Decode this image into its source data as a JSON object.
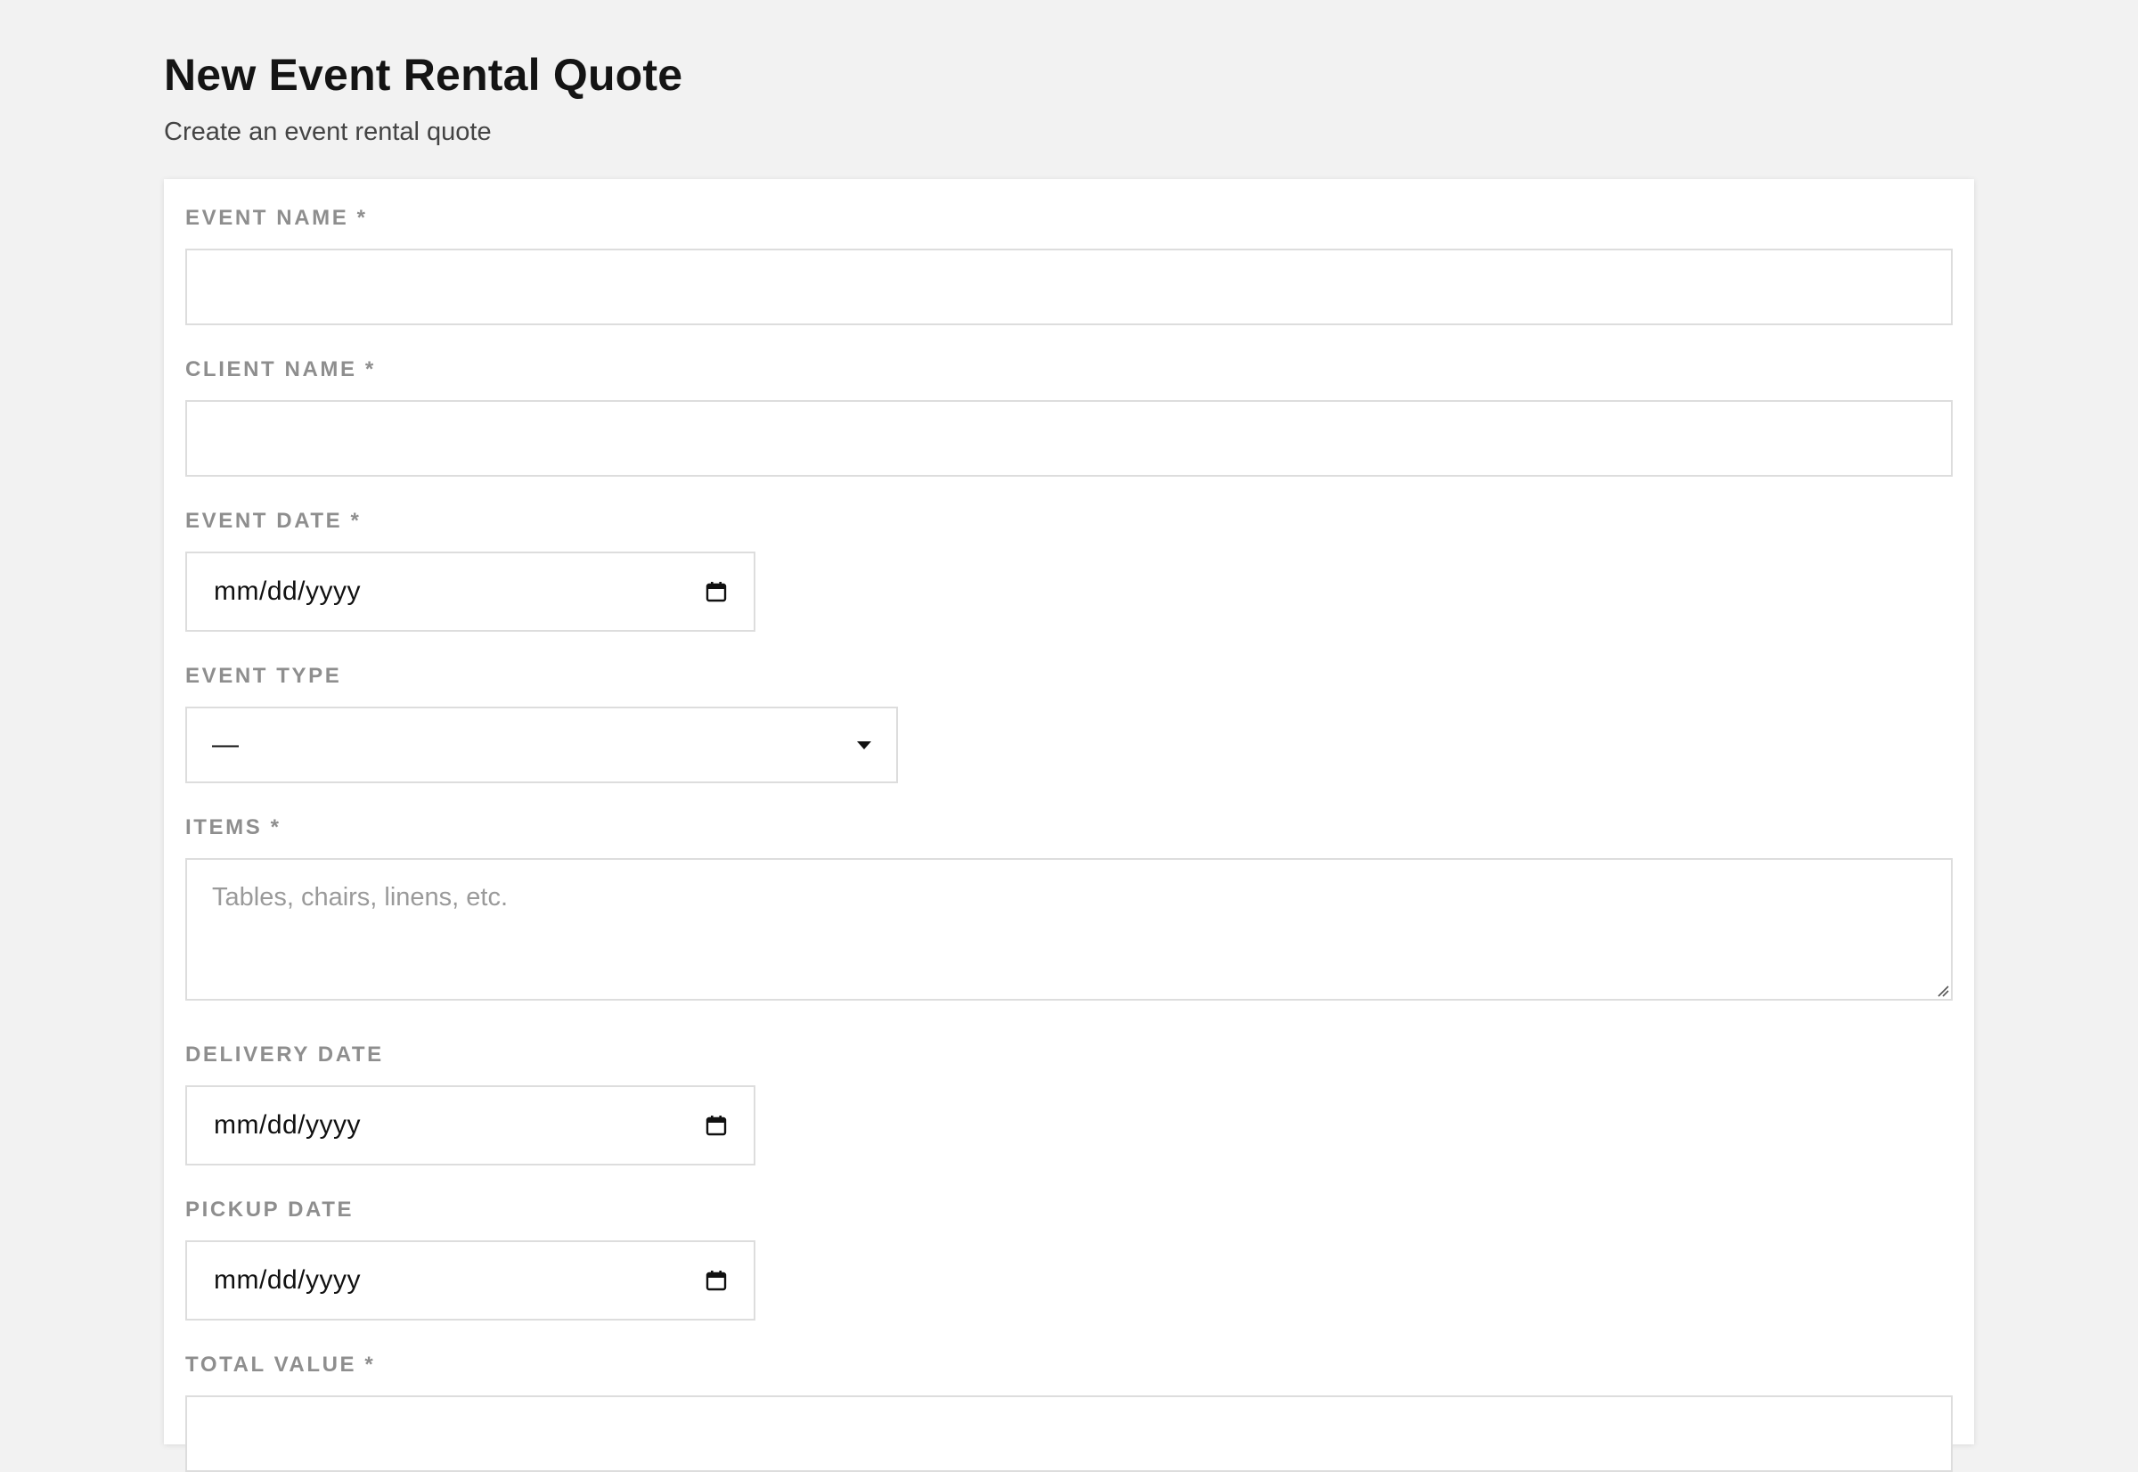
{
  "header": {
    "title": "New Event Rental Quote",
    "subtitle": "Create an event rental quote"
  },
  "form": {
    "event_name": {
      "label": "EVENT NAME *",
      "value": ""
    },
    "client_name": {
      "label": "CLIENT NAME *",
      "value": ""
    },
    "event_date": {
      "label": "EVENT DATE *",
      "placeholder": "mm/dd/yyyy"
    },
    "event_type": {
      "label": "EVENT TYPE",
      "selected": "—"
    },
    "items": {
      "label": "ITEMS *",
      "placeholder": "Tables, chairs, linens, etc."
    },
    "delivery_date": {
      "label": "DELIVERY DATE",
      "placeholder": "mm/dd/yyyy"
    },
    "pickup_date": {
      "label": "PICKUP DATE",
      "placeholder": "mm/dd/yyyy"
    },
    "total_value": {
      "label": "TOTAL VALUE *",
      "value": ""
    }
  },
  "icons": {
    "date_picker": "calendar-icon",
    "select": "chevron-down-icon",
    "resize": "resize-handle-icon"
  }
}
